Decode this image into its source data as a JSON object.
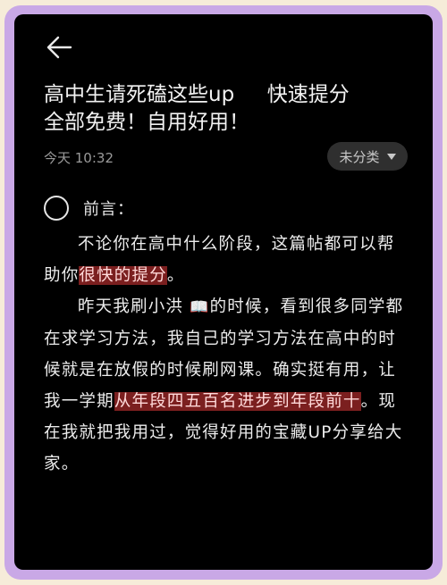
{
  "note": {
    "title": "高中生请死磕这些up     快速提分\n全部免费！自用好用！",
    "time": "今天 10:32",
    "category": "未分类",
    "preface_label": "前言：",
    "p1_a": "不论你在高中什么阶段，这篇帖都可以帮助你",
    "p1_hl": "很快的提分",
    "p1_b": "。",
    "p2_a": "昨天我刷小洪",
    "p2_emoji": "📖",
    "p2_b": "的时候，看到很多同学都在求学习方法，我自己的学习方法在高中的时候就是在放假的时候刷网课。确实挺有用，让我一学期",
    "p2_hl": "从年段四五百名进步到年段前十",
    "p2_c": "。现在我就把我用过，觉得好用的宝藏UP分享给大家。"
  },
  "icons": {
    "back": "arrow-left-icon",
    "dropdown": "triangle-down-icon",
    "checkbox": "circle-checkbox-icon"
  },
  "colors": {
    "screen_bg": "#000000",
    "frame_purple": "#c9a8e6",
    "highlight": "#7b1f1f"
  }
}
